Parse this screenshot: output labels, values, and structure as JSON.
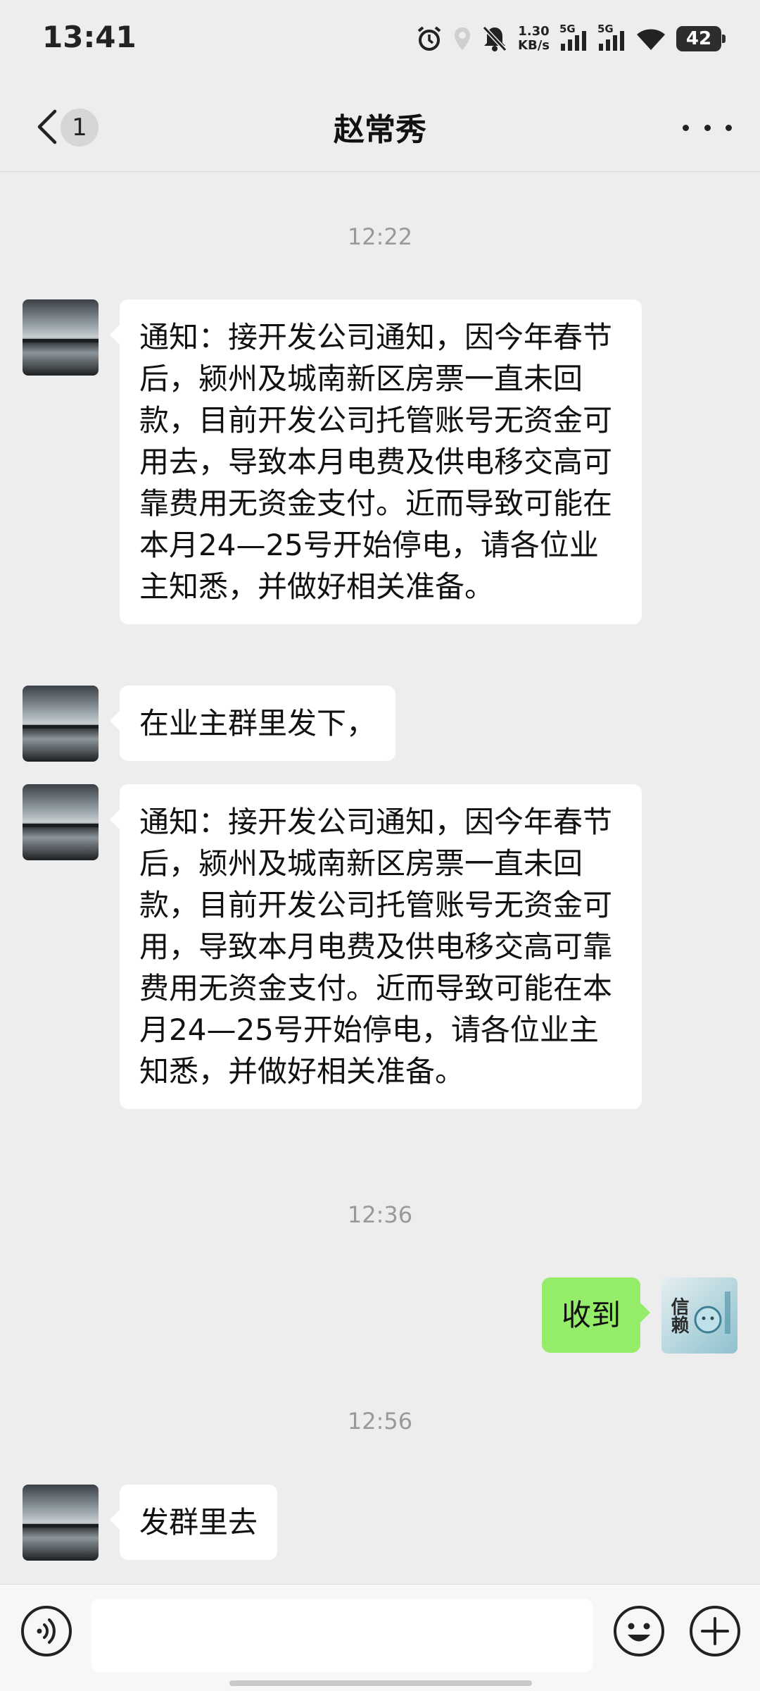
{
  "status_bar": {
    "time": "13:41",
    "net_speed_value": "1.30",
    "net_speed_unit": "KB/s",
    "signal1_label": "5G",
    "signal2_label": "5G",
    "battery": "42"
  },
  "header": {
    "back_icon": "chevron-left-icon",
    "unread_count": "1",
    "title": "赵常秀",
    "more_icon": "more-dots-icon"
  },
  "messages": [
    {
      "type": "time",
      "text": "12:22"
    },
    {
      "type": "received",
      "text": "通知：接开发公司通知，因今年春节后，颍州及城南新区房票一直未回款，目前开发公司托管账号无资金可用去，导致本月电费及供电移交高可靠费用无资金支付。近而导致可能在本月24—25号开始停电，请各位业主知悉，并做好相关准备。"
    },
    {
      "type": "received",
      "text": "在业主群里发下，"
    },
    {
      "type": "received",
      "text": "通知：接开发公司通知，因今年春节后，颍州及城南新区房票一直未回款，目前开发公司托管账号无资金可用，导致本月电费及供电移交高可靠费用无资金支付。近而导致可能在本月24—25号开始停电，请各位业主知悉，并做好相关准备。"
    },
    {
      "type": "time",
      "text": "12:36"
    },
    {
      "type": "sent",
      "text": "收到"
    },
    {
      "type": "time",
      "text": "12:56"
    },
    {
      "type": "received",
      "text": "发群里去"
    }
  ],
  "self_avatar_text": "信赖",
  "input_bar": {
    "voice_icon": "voice-icon",
    "emoji_icon": "emoji-icon",
    "plus_icon": "plus-icon",
    "input_value": ""
  }
}
